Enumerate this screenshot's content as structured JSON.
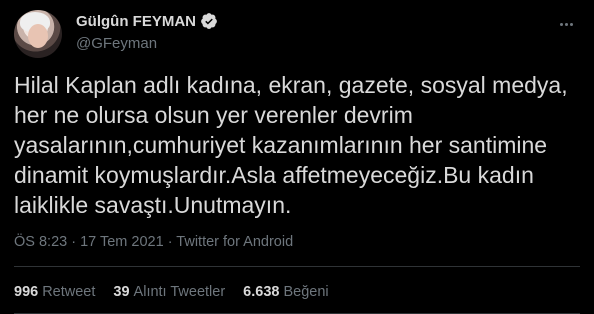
{
  "user": {
    "display_name": "Gülgûn FEYMAN",
    "handle": "@GFeyman",
    "verified": true
  },
  "tweet": {
    "text": "Hilal Kaplan adlı kadına, ekran, gazete, sosyal medya,\nher ne olursa olsun yer verenler devrim\nyasalarının,cumhuriyet kazanımlarının her santimine\ndinamit koymuşlardır.Asla affetmeyeceğiz.Bu kadın\nlaiklikle savaştı.Unutmayın.",
    "time": "ÖS 8:23",
    "separator": " · ",
    "date": "17 Tem 2021",
    "source": "Twitter for Android"
  },
  "stats": {
    "retweets_count": "996",
    "retweets_label": "Retweet",
    "quotes_count": "39",
    "quotes_label": "Alıntı Tweetler",
    "likes_count": "6.638",
    "likes_label": "Beğeni"
  },
  "colors": {
    "background": "#000000",
    "text": "#d9d9d9",
    "muted": "#6e767d",
    "verified": "#1d9bf0",
    "divider": "#2f3336"
  }
}
